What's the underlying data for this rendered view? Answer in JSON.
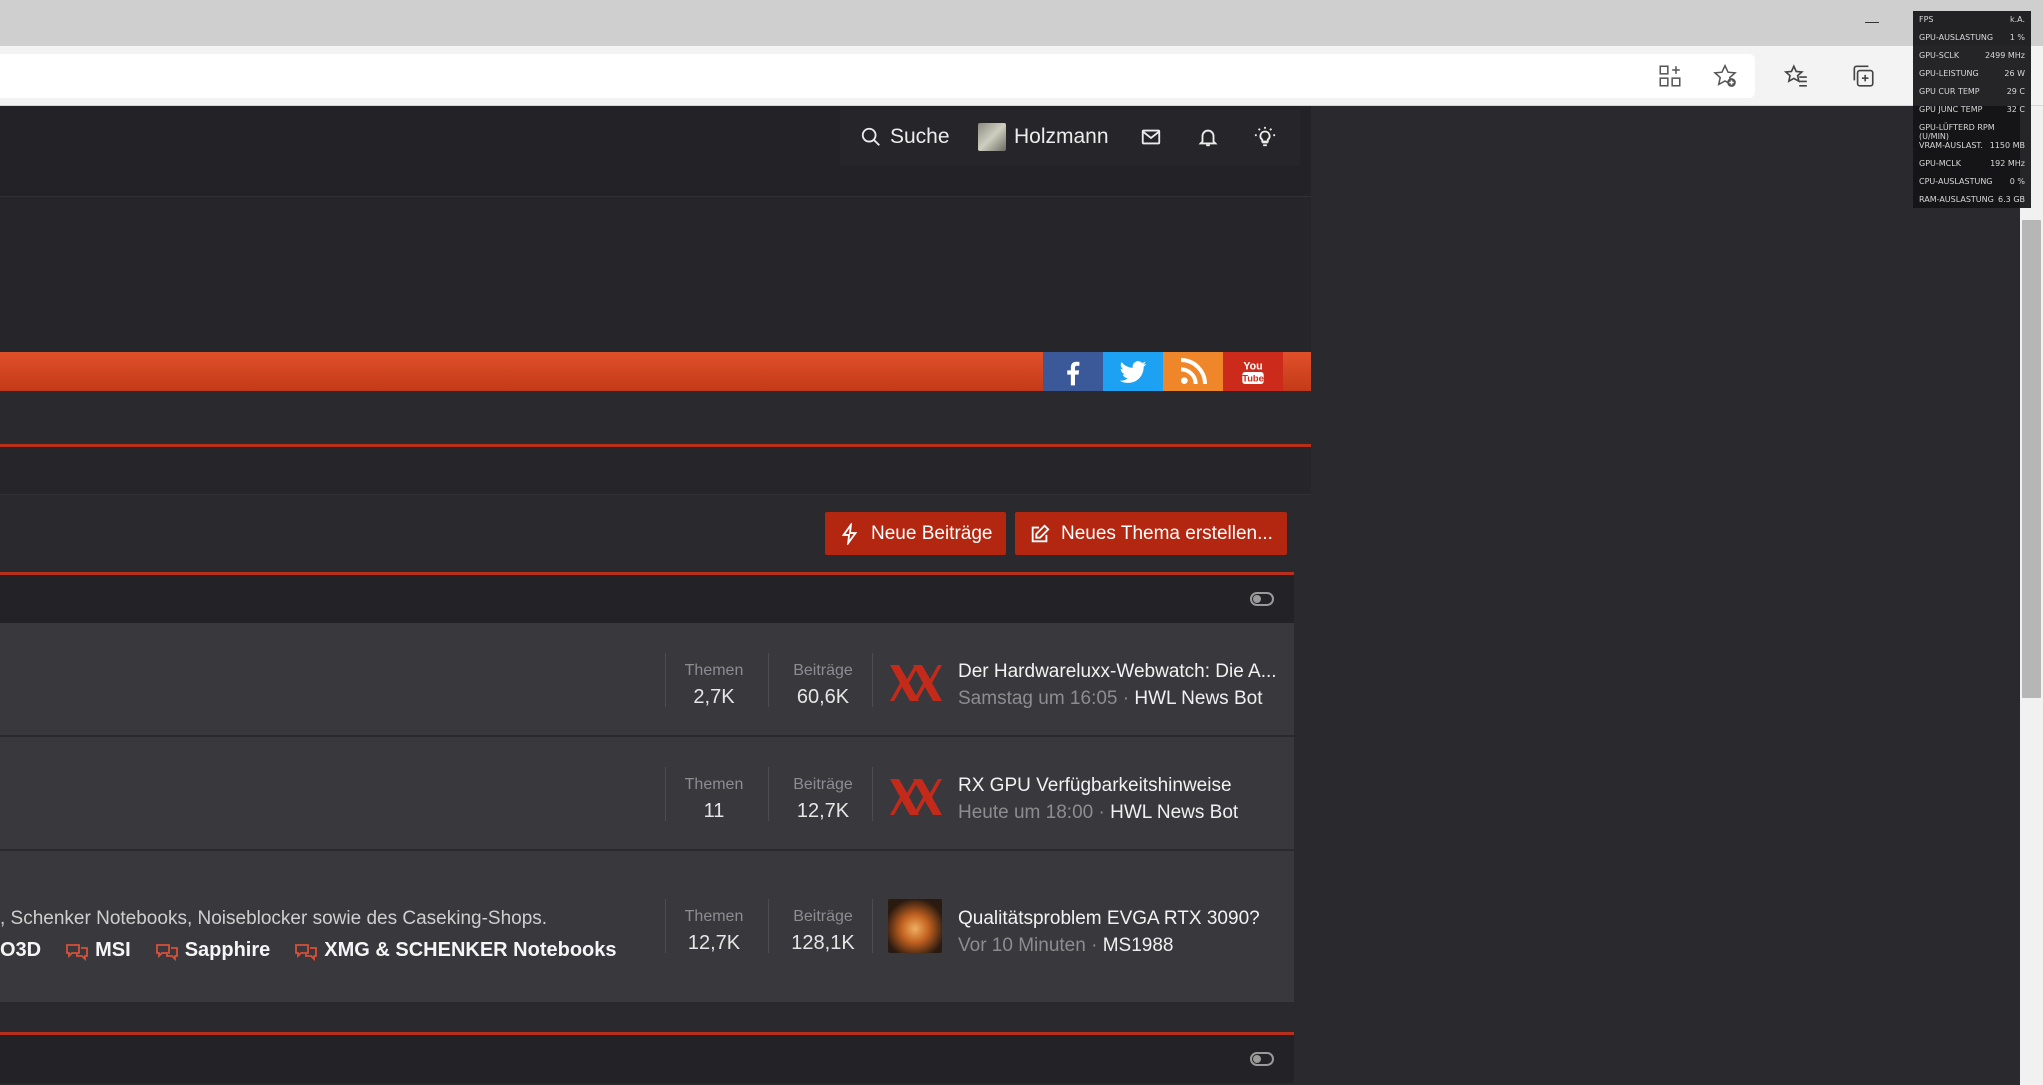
{
  "nav": {
    "search_label": "Suche",
    "user_name": "Holzmann"
  },
  "actions": {
    "new_posts": "Neue Beiträge",
    "new_thread": "Neues Thema erstellen..."
  },
  "forum_rows": [
    {
      "threads_label": "Themen",
      "threads": "2,7K",
      "posts_label": "Beiträge",
      "posts": "60,6K",
      "last_title": "Der Hardwareluxx-Webwatch: Die A...",
      "last_time": "Samstag um 16:05",
      "last_user": "HWL News Bot"
    },
    {
      "threads_label": "Themen",
      "threads": "11",
      "posts_label": "Beiträge",
      "posts": "12,7K",
      "last_title": "RX GPU Verfügbarkeitshinweise",
      "last_time": "Heute um 18:00",
      "last_user": "HWL News Bot"
    },
    {
      "description": ", Schenker Notebooks, Noiseblocker sowie des Caseking-Shops.",
      "subforums": [
        "O3D",
        "MSI",
        "Sapphire",
        "XMG & SCHENKER Notebooks"
      ],
      "threads_label": "Themen",
      "threads": "12,7K",
      "posts_label": "Beiträge",
      "posts": "128,1K",
      "last_title": "Qualitätsproblem EVGA RTX 3090?",
      "last_time": "Vor 10 Minuten",
      "last_user": "MS1988"
    }
  ],
  "separator": " · ",
  "overlay": [
    {
      "label": "FPS",
      "value": "k.A."
    },
    {
      "label": "GPU-AUSLASTUNG",
      "value": "1 %"
    },
    {
      "label": "GPU-SCLK",
      "value": "2499 MHz"
    },
    {
      "label": "GPU-LEISTUNG",
      "value": "26 W"
    },
    {
      "label": "GPU CUR TEMP",
      "value": "29 C"
    },
    {
      "label": "GPU JUNC TEMP",
      "value": "32 C"
    },
    {
      "label": "GPU-LÜFTERD RPM (U/MIN)",
      "value": ""
    },
    {
      "label": "VRAM-AUSLAST.",
      "value": "1150 MB"
    },
    {
      "label": "GPU-MCLK",
      "value": "192 MHz"
    },
    {
      "label": "CPU-AUSLASTUNG",
      "value": "0 %"
    },
    {
      "label": "RAM-AUSLASTUNG",
      "value": "6.3 GB"
    }
  ],
  "colors": {
    "accent": "#b3260f",
    "orange_bar": "#d9451f",
    "facebook": "#3b5998",
    "twitter": "#1da1f2",
    "rss": "#f0862a",
    "youtube": "#cc2a1a"
  }
}
